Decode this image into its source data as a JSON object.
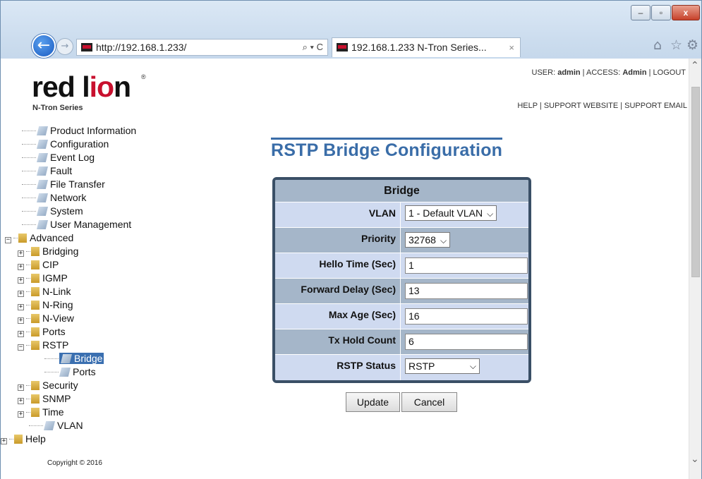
{
  "browser": {
    "url": "http://192.168.1.233/",
    "tab_title": "192.168.1.233 N-Tron Series...",
    "tab_close": "×",
    "search_refresh": "⌕ ▾ C",
    "win_min": "–",
    "win_max": "▫",
    "win_close": "x",
    "home_icon": "⌂",
    "star_icon": "☆",
    "gear_icon": "⚙"
  },
  "header": {
    "logo_text_pre": "red l",
    "logo_text_o": "io",
    "logo_text_post": "n",
    "logo_reg": "®",
    "logo_sub": "N-Tron Series",
    "user_prefix": "USER: ",
    "user": "admin",
    "access_prefix": " | ACCESS: ",
    "access": "Admin",
    "logout": " | LOGOUT",
    "help_links": "HELP | SUPPORT WEBSITE | SUPPORT EMAIL"
  },
  "tree": {
    "product_information": "Product Information",
    "configuration": "Configuration",
    "event_log": "Event Log",
    "fault": "Fault",
    "file_transfer": "File Transfer",
    "network": "Network",
    "system": "System",
    "user_management": "User Management",
    "advanced": "Advanced",
    "bridging": "Bridging",
    "cip": "CIP",
    "igmp": "IGMP",
    "nlink": "N-Link",
    "nring": "N-Ring",
    "nview": "N-View",
    "ports": "Ports",
    "rstp": "RSTP",
    "rstp_bridge": "Bridge",
    "rstp_ports": "Ports",
    "security": "Security",
    "snmp": "SNMP",
    "time": "Time",
    "vlan": "VLAN",
    "help": "Help",
    "copyright": "Copyright © 2016"
  },
  "main": {
    "title": "RSTP Bridge Configuration",
    "table_header": "Bridge",
    "vlan_label": "VLAN",
    "vlan_value": "1 - Default VLAN",
    "priority_label": "Priority",
    "priority_value": "32768",
    "hello_label": "Hello Time (Sec)",
    "hello_value": "1",
    "fwd_label": "Forward Delay (Sec)",
    "fwd_value": "13",
    "maxage_label": "Max Age (Sec)",
    "maxage_value": "16",
    "txhold_label": "Tx Hold Count",
    "txhold_value": "6",
    "status_label": "RSTP Status",
    "status_value": "RSTP",
    "update": "Update",
    "cancel": "Cancel"
  }
}
